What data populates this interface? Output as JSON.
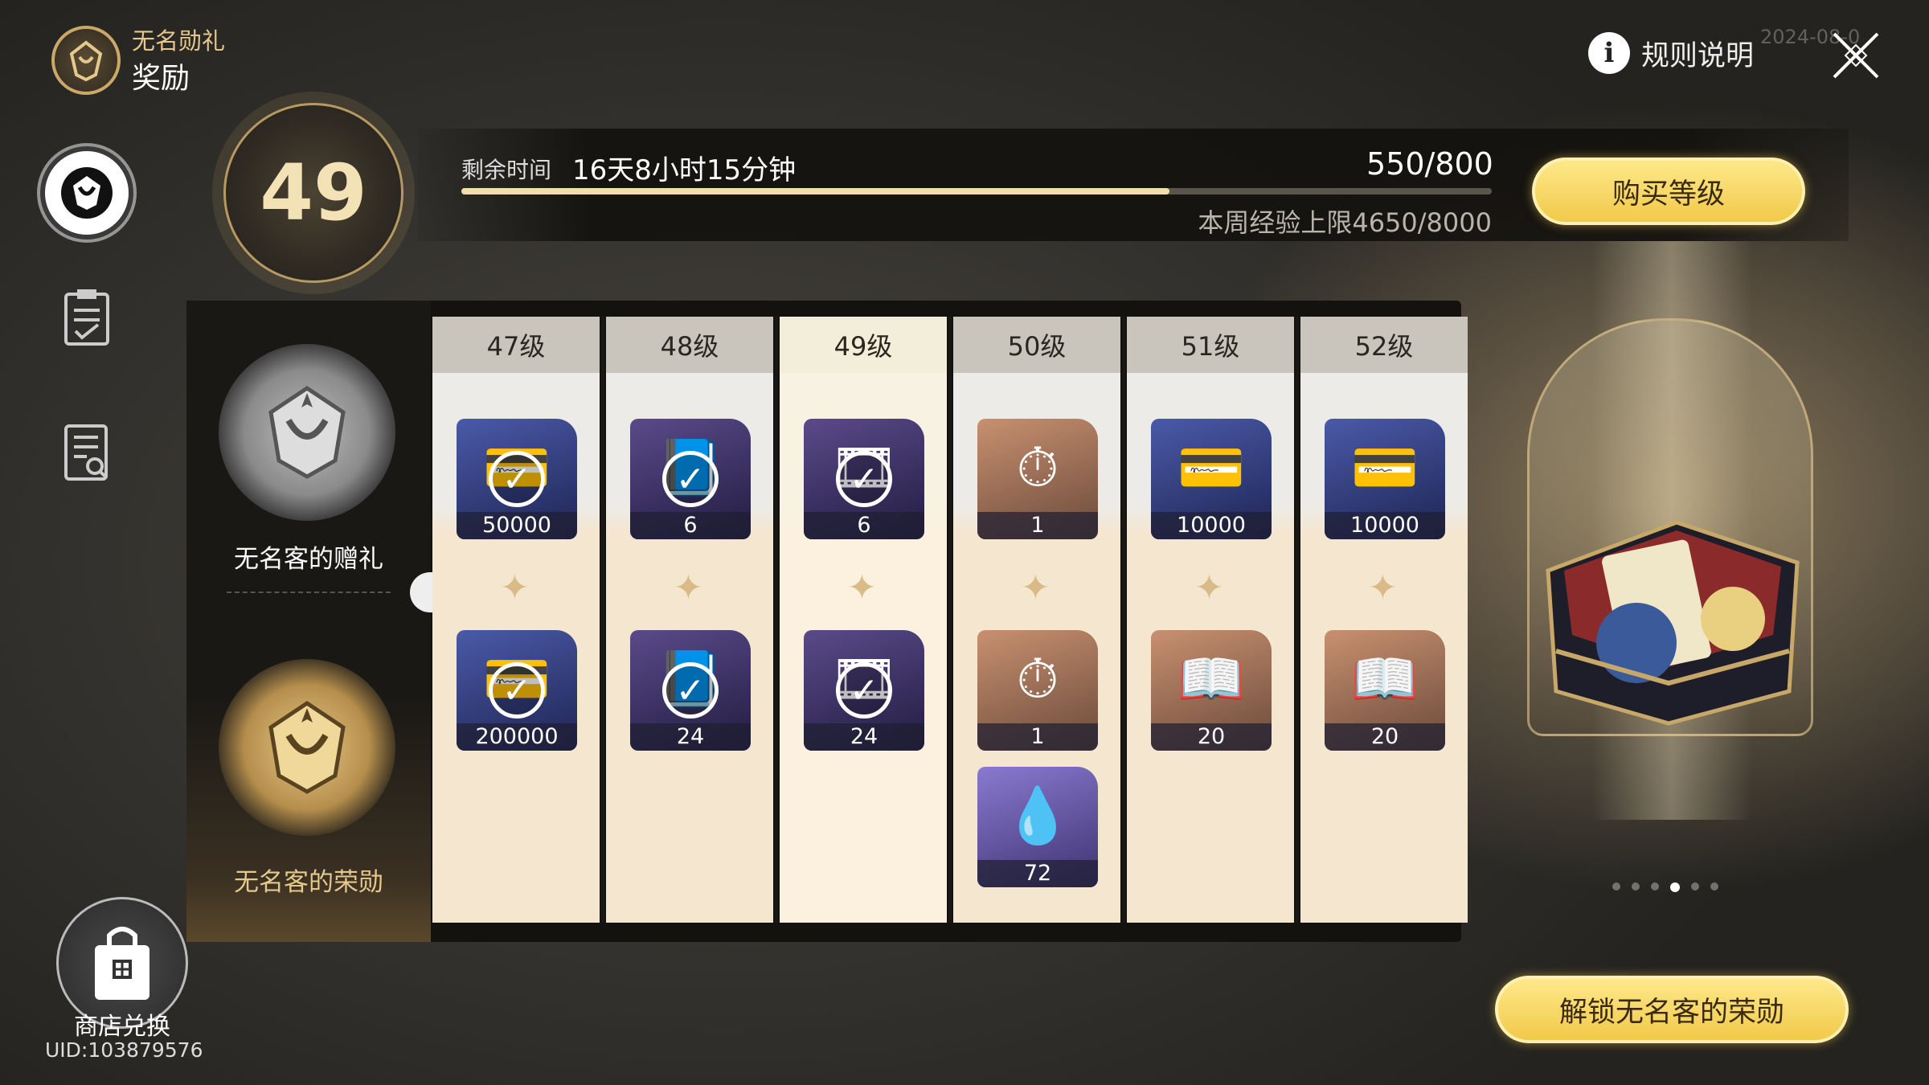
{
  "header": {
    "title": "无名勋礼",
    "subtitle": "奖励",
    "rules_label": "规则说明",
    "watermark": "2024-08-0"
  },
  "sidebar": {
    "icons": [
      "reward-emblem-icon",
      "task-clipboard-icon",
      "search-document-icon"
    ]
  },
  "level": {
    "current": "49",
    "time_label": "剩余时间",
    "time_value": "16天8小时15分钟",
    "exp": "550/800",
    "exp_fraction": 0.6875,
    "weekly_cap": "本周经验上限4650/8000",
    "buy_label": "购买等级"
  },
  "tracks": {
    "free_label": "无名客的赠礼",
    "paid_label": "无名客的荣勋"
  },
  "columns": [
    {
      "level": "47级",
      "free": [
        {
          "count": "50000",
          "icon": "credit-card-icon",
          "style": "blue",
          "claimed": true
        }
      ],
      "paid": [
        {
          "count": "200000",
          "icon": "credit-card-icon",
          "style": "blue",
          "claimed": true
        }
      ]
    },
    {
      "level": "48级",
      "free": [
        {
          "count": "6",
          "icon": "relic-book-icon",
          "style": "purple",
          "claimed": true
        }
      ],
      "paid": [
        {
          "count": "24",
          "icon": "relic-book-icon",
          "style": "purple",
          "claimed": true
        }
      ]
    },
    {
      "level": "49级",
      "free": [
        {
          "count": "6",
          "icon": "film-reel-icon",
          "style": "purple",
          "claimed": true
        }
      ],
      "paid": [
        {
          "count": "24",
          "icon": "film-reel-icon",
          "style": "purple",
          "claimed": true
        }
      ],
      "current": true
    },
    {
      "level": "50级",
      "free": [
        {
          "count": "1",
          "icon": "gold-pocket-watch-icon",
          "style": "brown",
          "claimed": false
        }
      ],
      "paid": [
        {
          "count": "1",
          "icon": "gold-pocket-watch-icon",
          "style": "brown",
          "claimed": false
        },
        {
          "count": "72",
          "icon": "crystal-flask-icon",
          "style": "lav",
          "claimed": false
        }
      ]
    },
    {
      "level": "51级",
      "free": [
        {
          "count": "10000",
          "icon": "credit-card-icon",
          "style": "blue",
          "claimed": false
        }
      ],
      "paid": [
        {
          "count": "20",
          "icon": "book-icon",
          "style": "brown",
          "claimed": false
        }
      ]
    },
    {
      "level": "52级",
      "free": [
        {
          "count": "10000",
          "icon": "credit-card-icon",
          "style": "blue",
          "claimed": false
        }
      ],
      "paid": [
        {
          "count": "20",
          "icon": "book-icon",
          "style": "brown",
          "claimed": false
        }
      ]
    }
  ],
  "showcase": {
    "unlock_label": "解锁无名客的荣勋",
    "pages": 6,
    "active_page": 4
  },
  "shop": {
    "label": "商店兑换",
    "uid": "UID:103879576"
  },
  "colors": {
    "accent_gold": "#f2c94a",
    "progress_fill": "#f1dfa6"
  }
}
